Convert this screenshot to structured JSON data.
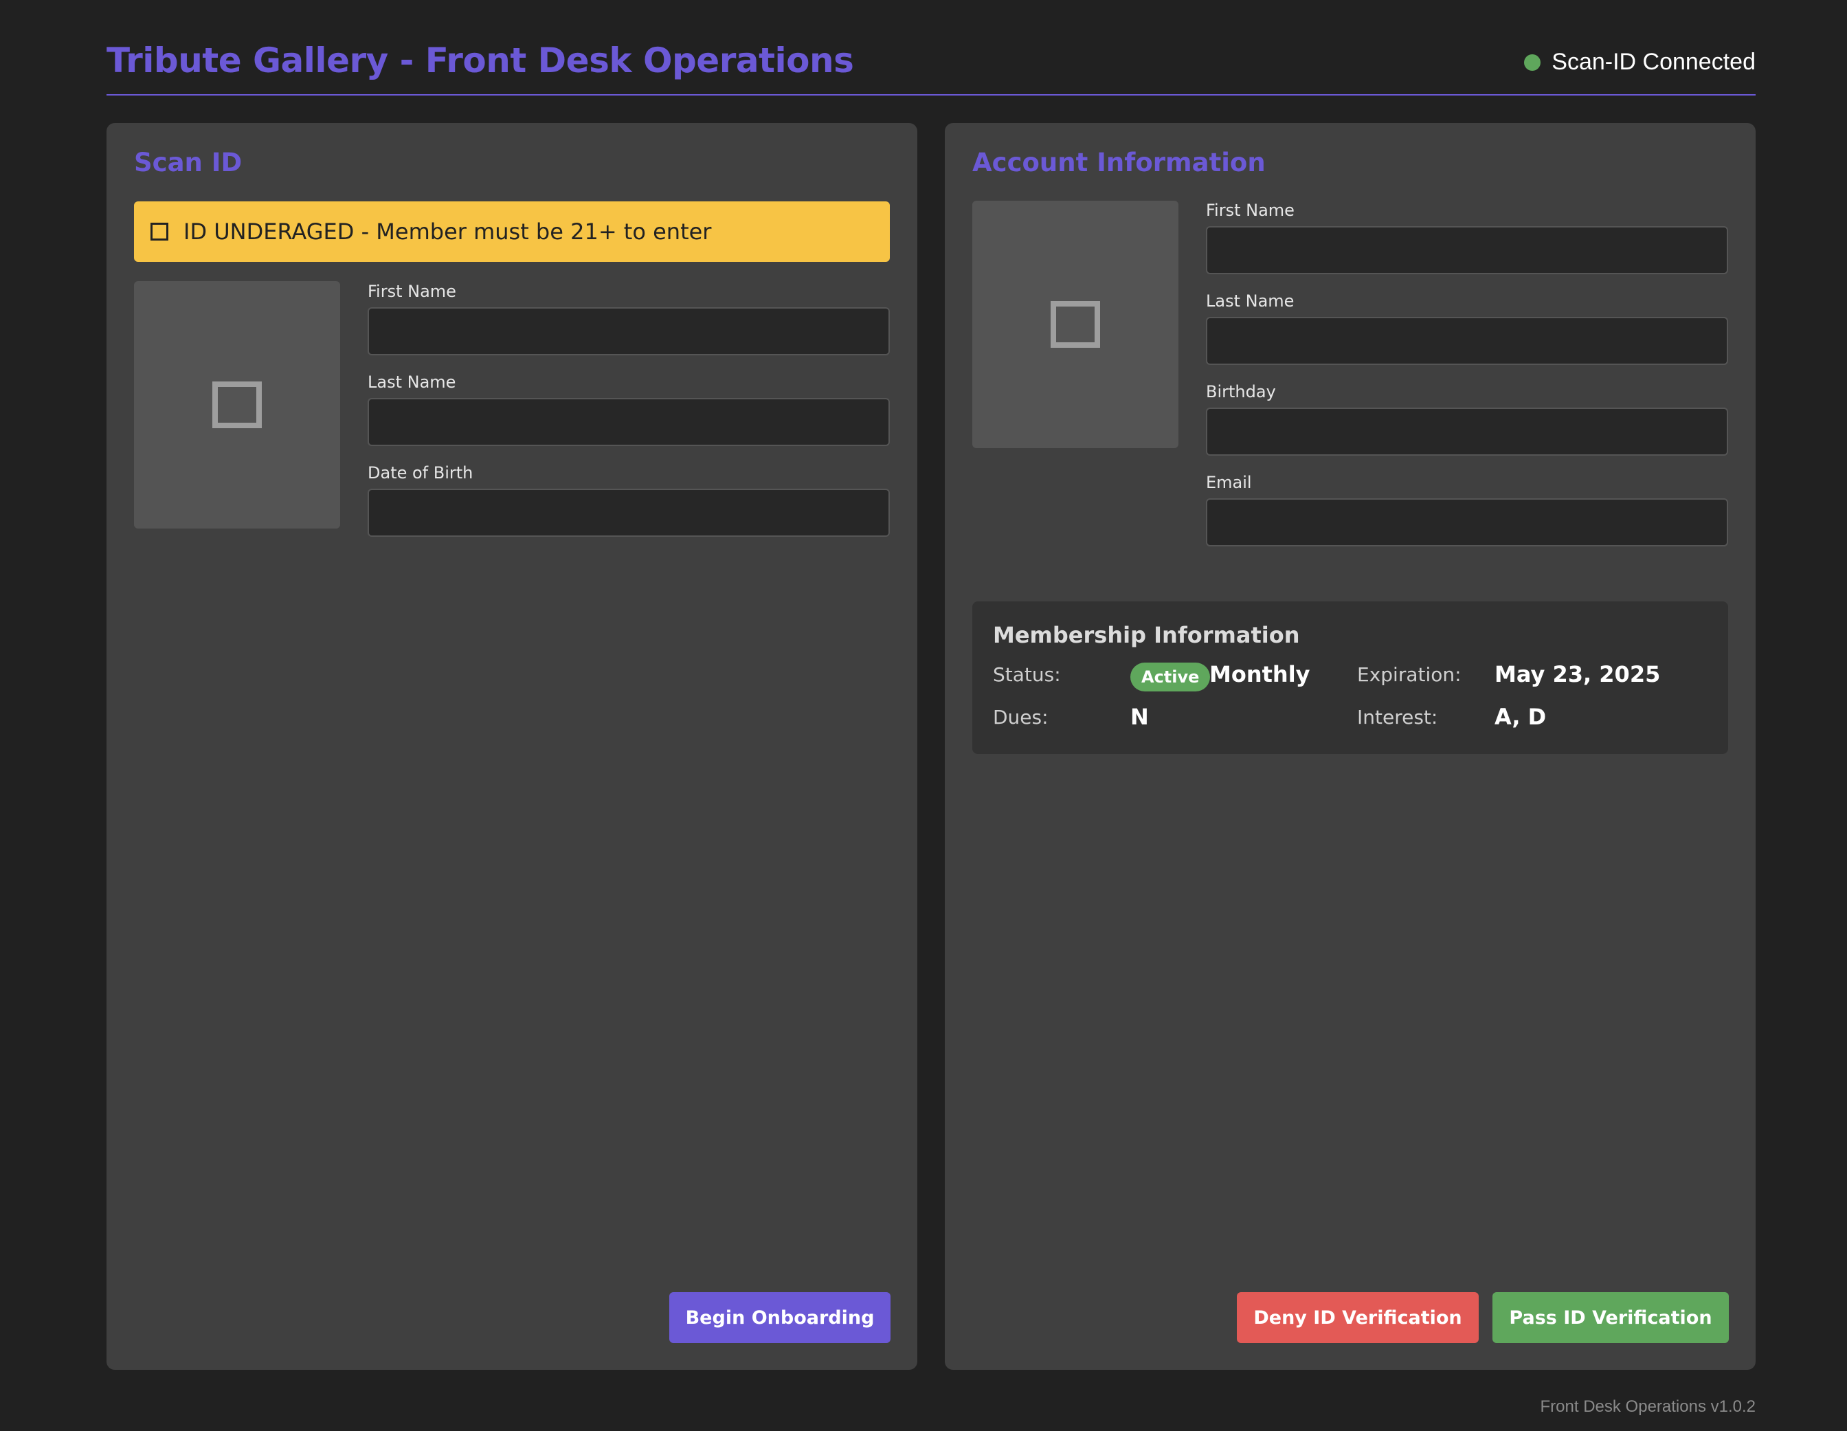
{
  "header": {
    "title": "Tribute Gallery - Front Desk Operations",
    "connection_status": "Scan-ID Connected",
    "connection_color": "#5fa75c"
  },
  "scan_panel": {
    "title": "Scan ID",
    "warning": {
      "icon": "warning-square-icon",
      "text": "ID UNDERAGED - Member must be 21+ to enter",
      "color": "#f7c445"
    },
    "photo_icon": "image-placeholder-icon",
    "fields": {
      "first_name": {
        "label": "First Name",
        "value": ""
      },
      "last_name": {
        "label": "Last Name",
        "value": ""
      },
      "dob": {
        "label": "Date of Birth",
        "value": ""
      }
    },
    "onboard_button": "Begin Onboarding"
  },
  "account_panel": {
    "title": "Account Information",
    "photo_icon": "image-placeholder-icon",
    "fields": {
      "first_name": {
        "label": "First Name",
        "value": ""
      },
      "last_name": {
        "label": "Last Name",
        "value": ""
      },
      "birthday": {
        "label": "Birthday",
        "value": ""
      },
      "email": {
        "label": "Email",
        "value": ""
      }
    },
    "membership": {
      "title": "Membership Information",
      "status_label": "Status:",
      "status_badge": "Active",
      "status_plan": "Monthly",
      "expiration_label": "Expiration:",
      "expiration_value": "May 23, 2025",
      "dues_label": "Dues:",
      "dues_value": "N",
      "interest_label": "Interest:",
      "interest_value": "A, D"
    },
    "deny_button": "Deny ID Verification",
    "pass_button": "Pass ID Verification"
  },
  "colors": {
    "accent": "#6b59d6",
    "deny": "#e35a56",
    "pass": "#5fa75c"
  },
  "footer": "Front Desk Operations v1.0.2"
}
